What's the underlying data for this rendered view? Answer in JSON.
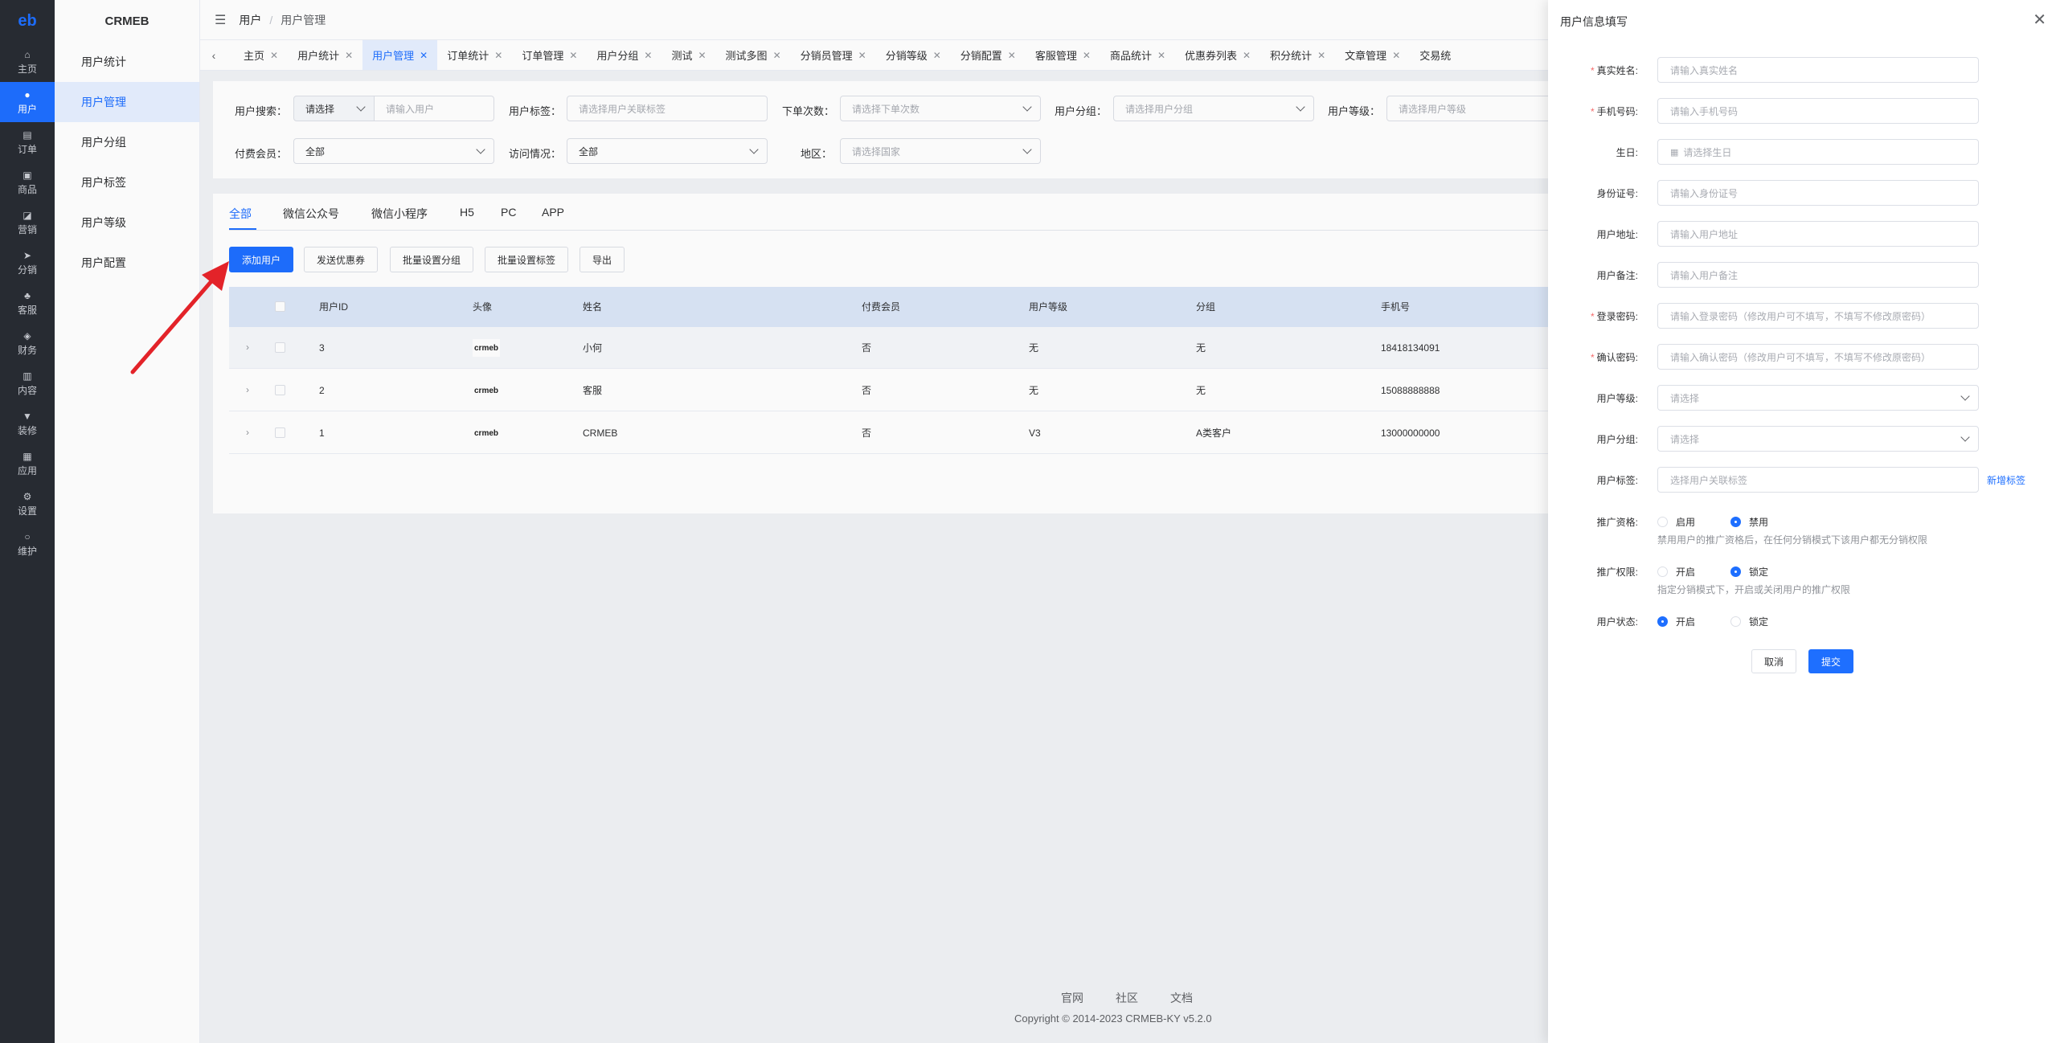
{
  "nav": {
    "logo": "eb",
    "items": [
      {
        "icon": "⌂",
        "label": "主页"
      },
      {
        "icon": "●",
        "label": "用户"
      },
      {
        "icon": "▤",
        "label": "订单"
      },
      {
        "icon": "▣",
        "label": "商品"
      },
      {
        "icon": "◪",
        "label": "营销"
      },
      {
        "icon": "➤",
        "label": "分销"
      },
      {
        "icon": "♣",
        "label": "客服"
      },
      {
        "icon": "◈",
        "label": "财务"
      },
      {
        "icon": "▥",
        "label": "内容"
      },
      {
        "icon": "▼",
        "label": "装修"
      },
      {
        "icon": "▦",
        "label": "应用"
      },
      {
        "icon": "⚙",
        "label": "设置"
      },
      {
        "icon": "○",
        "label": "维护"
      }
    ]
  },
  "submenu": {
    "title": "CRMEB",
    "items": [
      "用户统计",
      "用户管理",
      "用户分组",
      "用户标签",
      "用户等级",
      "用户配置"
    ]
  },
  "header": {
    "crumb1": "用户",
    "crumb2": "用户管理"
  },
  "tabs": [
    "主页",
    "用户统计",
    "用户管理",
    "订单统计",
    "订单管理",
    "用户分组",
    "测试",
    "测试多图",
    "分销员管理",
    "分销等级",
    "分销配置",
    "客服管理",
    "商品统计",
    "优惠券列表",
    "积分统计",
    "文章管理",
    "交易统"
  ],
  "filters": {
    "search_label": "用户搜索：",
    "search_select": "请选择",
    "search_placeholder": "请输入用户",
    "tag_label": "用户标签：",
    "tag_placeholder": "请选择用户关联标签",
    "orders_label": "下单次数：",
    "orders_placeholder": "请选择下单次数",
    "group_label": "用户分组：",
    "group_placeholder": "请选择用户分组",
    "level_label": "用户等级：",
    "level_placeholder": "请选择用户等级",
    "member_label": "付费会员：",
    "member_value": "全部",
    "visit_label": "访问情况：",
    "visit_value": "全部",
    "region_label": "地区：",
    "region_placeholder": "请选择国家"
  },
  "list": {
    "tabs": [
      "全部",
      "微信公众号",
      "微信小程序",
      "H5",
      "PC",
      "APP"
    ],
    "buttons": [
      "添加用户",
      "发送优惠券",
      "批量设置分组",
      "批量设置标签",
      "导出"
    ],
    "columns": [
      "用户ID",
      "头像",
      "姓名",
      "付费会员",
      "用户等级",
      "分组",
      "手机号"
    ],
    "rows": [
      {
        "id": "3",
        "avatar": "crmeb",
        "name": "小何",
        "member": "否",
        "level": "无",
        "group": "无",
        "phone": "18418134091"
      },
      {
        "id": "2",
        "avatar": "crmeb",
        "name": "客服",
        "member": "否",
        "level": "无",
        "group": "无",
        "phone": "15088888888"
      },
      {
        "id": "1",
        "avatar": "crmeb",
        "name": "CRMEB",
        "member": "否",
        "level": "V3",
        "group": "A类客户",
        "phone": "13000000000"
      }
    ]
  },
  "footer": {
    "links": [
      "官网",
      "社区",
      "文档"
    ],
    "copyright": "Copyright © 2014-2023 CRMEB-KY v5.2.0"
  },
  "drawer": {
    "title": "用户信息填写",
    "real_name": {
      "label": "真实姓名:",
      "placeholder": "请输入真实姓名"
    },
    "phone": {
      "label": "手机号码:",
      "placeholder": "请输入手机号码"
    },
    "birthday": {
      "label": "生日:",
      "placeholder": "请选择生日"
    },
    "id_card": {
      "label": "身份证号:",
      "placeholder": "请输入身份证号"
    },
    "address": {
      "label": "用户地址:",
      "placeholder": "请输入用户地址"
    },
    "remark": {
      "label": "用户备注:",
      "placeholder": "请输入用户备注"
    },
    "password": {
      "label": "登录密码:",
      "placeholder": "请输入登录密码（修改用户可不填写，不填写不修改原密码）"
    },
    "confirm_password": {
      "label": "确认密码:",
      "placeholder": "请输入确认密码（修改用户可不填写，不填写不修改原密码）"
    },
    "level": {
      "label": "用户等级:",
      "placeholder": "请选择"
    },
    "group": {
      "label": "用户分组:",
      "placeholder": "请选择"
    },
    "tags": {
      "label": "用户标签:",
      "placeholder": "选择用户关联标签",
      "add": "新增标签"
    },
    "promo": {
      "label": "推广资格:",
      "opt1": "启用",
      "opt2": "禁用",
      "selected": "禁用",
      "hint": "禁用用户的推广资格后，在任何分销模式下该用户都无分销权限"
    },
    "promo_perm": {
      "label": "推广权限:",
      "opt1": "开启",
      "opt2": "锁定",
      "selected": "锁定",
      "hint": "指定分销模式下，开启或关闭用户的推广权限"
    },
    "status": {
      "label": "用户状态:",
      "opt1": "开启",
      "opt2": "锁定",
      "selected": "开启"
    },
    "cancel": "取消",
    "submit": "提交"
  },
  "colors": {
    "accent": "#1e6fff",
    "sidebar": "#282c34",
    "arrow": "#e8242a"
  }
}
